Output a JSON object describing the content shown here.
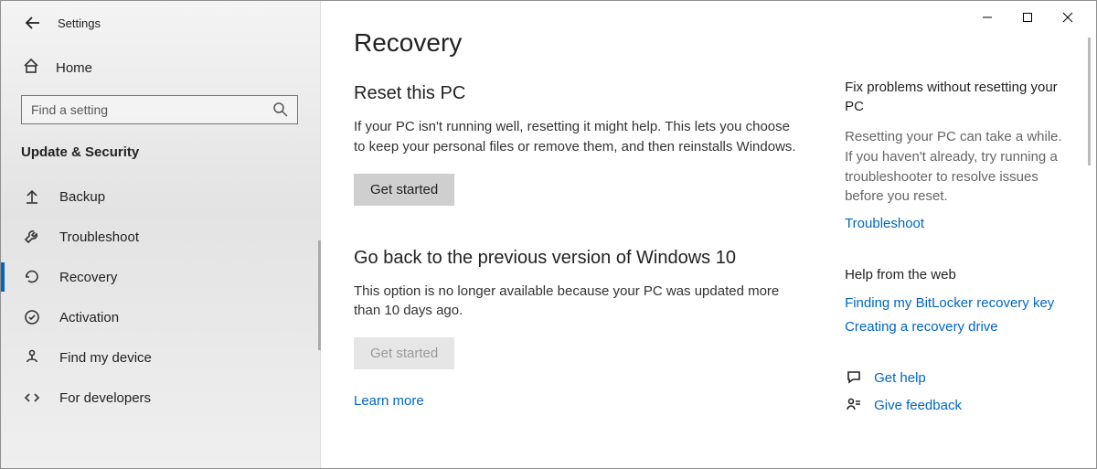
{
  "app_title": "Settings",
  "search": {
    "placeholder": "Find a setting"
  },
  "home_label": "Home",
  "group_title": "Update & Security",
  "nav": {
    "items": [
      {
        "label": "Backup",
        "selected": false
      },
      {
        "label": "Troubleshoot",
        "selected": false
      },
      {
        "label": "Recovery",
        "selected": true
      },
      {
        "label": "Activation",
        "selected": false
      },
      {
        "label": "Find my device",
        "selected": false
      },
      {
        "label": "For developers",
        "selected": false
      }
    ]
  },
  "page": {
    "title": "Recovery",
    "reset": {
      "title": "Reset this PC",
      "desc": "If your PC isn't running well, resetting it might help. This lets you choose to keep your personal files or remove them, and then reinstalls Windows.",
      "button": "Get started"
    },
    "goback": {
      "title": "Go back to the previous version of Windows 10",
      "desc": "This option is no longer available because your PC was updated more than 10 days ago.",
      "button": "Get started",
      "learn_more": "Learn more"
    }
  },
  "sidepanel": {
    "fix": {
      "title": "Fix problems without resetting your PC",
      "desc": "Resetting your PC can take a while. If you haven't already, try running a troubleshooter to resolve issues before you reset.",
      "link": "Troubleshoot"
    },
    "webhelp": {
      "title": "Help from the web",
      "links": {
        "bitlocker": "Finding my BitLocker recovery key",
        "drive": "Creating a recovery drive"
      }
    },
    "footer": {
      "get_help": "Get help",
      "feedback": "Give feedback"
    }
  }
}
